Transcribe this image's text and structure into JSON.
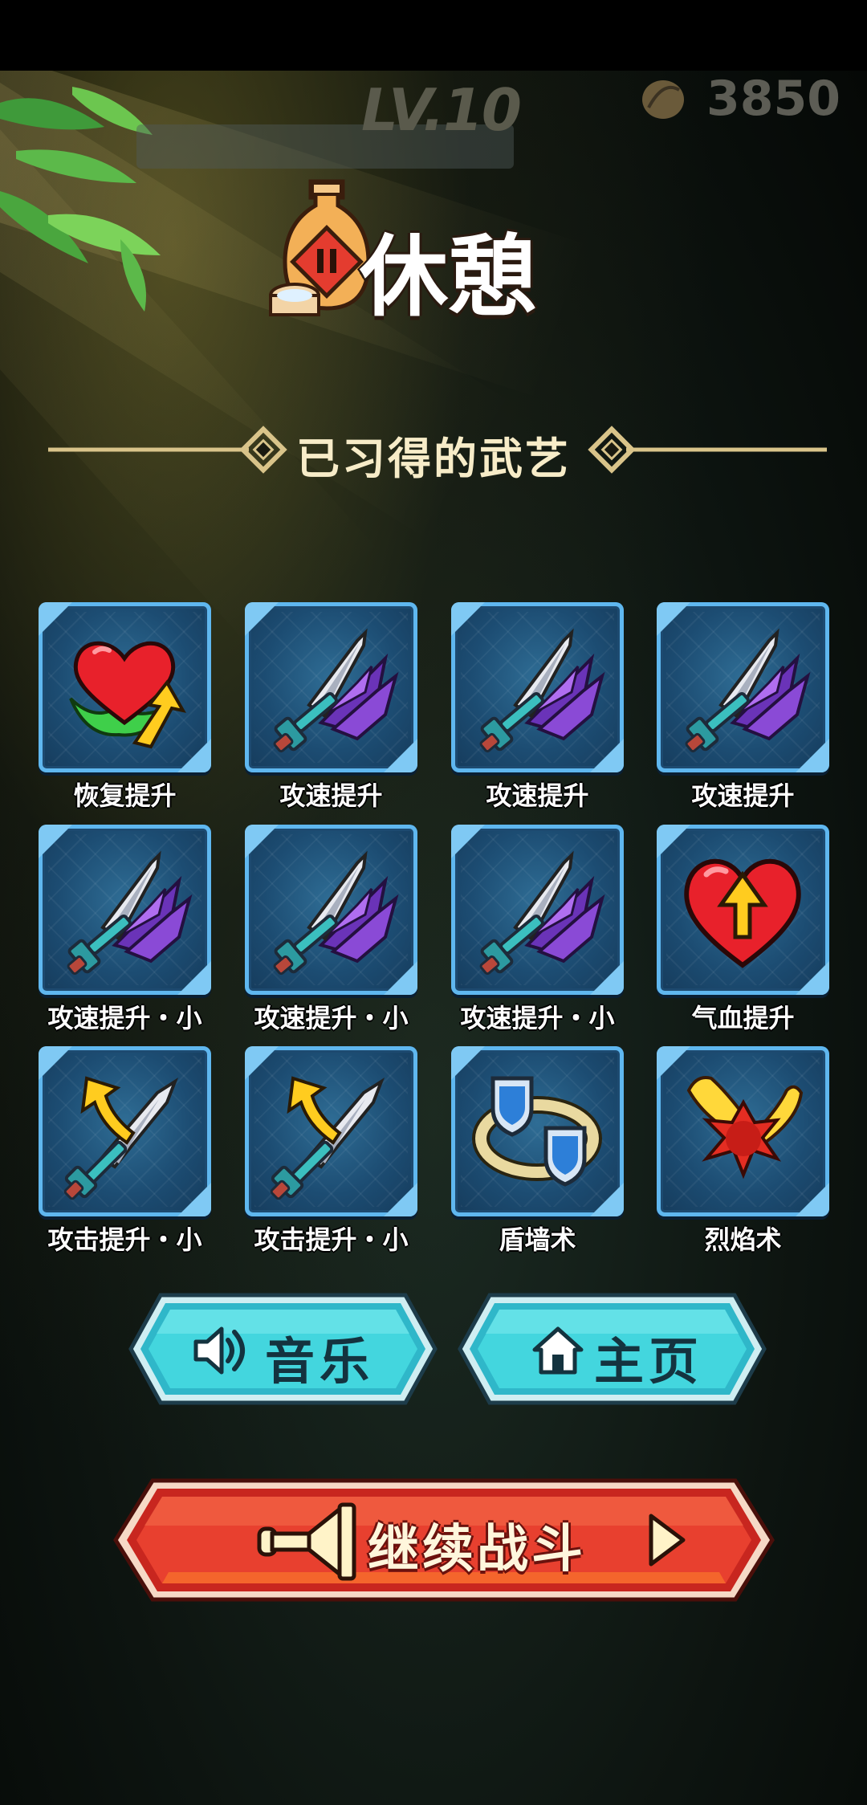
{
  "hud": {
    "level": "LV.10",
    "coins": "3850",
    "coin_icon": "leaf-coin-icon"
  },
  "title": {
    "text": "休憩",
    "icon": "wine-jar-pause-icon"
  },
  "section": {
    "title": "已习得的武艺"
  },
  "skills": [
    {
      "label": "恢复提升",
      "icon": "heart-heal-up-icon"
    },
    {
      "label": "攻速提升",
      "icon": "claw-sword-icon"
    },
    {
      "label": "攻速提升",
      "icon": "claw-sword-icon"
    },
    {
      "label": "攻速提升",
      "icon": "claw-sword-icon"
    },
    {
      "label": "攻速提升・小",
      "icon": "claw-sword-icon"
    },
    {
      "label": "攻速提升・小",
      "icon": "claw-sword-icon"
    },
    {
      "label": "攻速提升・小",
      "icon": "claw-sword-icon"
    },
    {
      "label": "气血提升",
      "icon": "heart-up-icon"
    },
    {
      "label": "攻击提升・小",
      "icon": "sword-up-icon"
    },
    {
      "label": "攻击提升・小",
      "icon": "sword-up-icon"
    },
    {
      "label": "盾墙术",
      "icon": "shield-ring-icon"
    },
    {
      "label": "烈焰术",
      "icon": "fireball-icon"
    }
  ],
  "buttons": {
    "music": {
      "label": "音乐",
      "icon": "speaker-icon"
    },
    "home": {
      "label": "主页",
      "icon": "home-icon"
    },
    "continue": {
      "label": "继续战斗",
      "icon": "horn-icon"
    }
  },
  "colors": {
    "card_border": "#5fb7ef",
    "blue_button": "#38c9d6",
    "red_button": "#e5352b",
    "gold_line": "#d9c48a"
  }
}
